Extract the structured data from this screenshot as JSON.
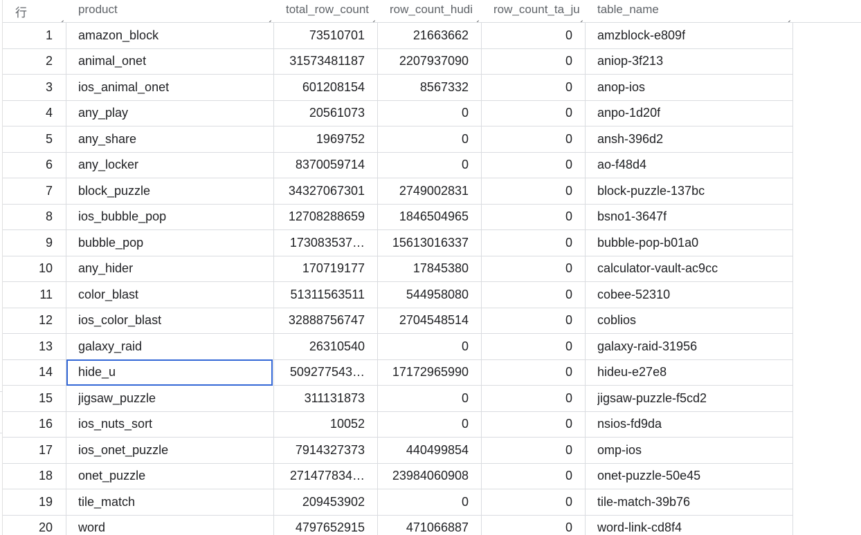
{
  "table": {
    "columns": {
      "row": "行",
      "product": "product",
      "total_row_count": "total_row_count",
      "row_count_hudi": "row_count_hudi",
      "row_count_ta_ju": "row_count_ta_ju",
      "table_name": "table_name"
    },
    "selected_row_index": 14,
    "selected_column": "product",
    "rows": [
      {
        "n": "1",
        "product": "amazon_block",
        "total": "73510701",
        "hudi": "21663662",
        "ta": "0",
        "table_name": "amzblock-e809f"
      },
      {
        "n": "2",
        "product": "animal_onet",
        "total": "31573481187",
        "hudi": "2207937090",
        "ta": "0",
        "table_name": "aniop-3f213"
      },
      {
        "n": "3",
        "product": "ios_animal_onet",
        "total": "601208154",
        "hudi": "8567332",
        "ta": "0",
        "table_name": "anop-ios"
      },
      {
        "n": "4",
        "product": "any_play",
        "total": "20561073",
        "hudi": "0",
        "ta": "0",
        "table_name": "anpo-1d20f"
      },
      {
        "n": "5",
        "product": "any_share",
        "total": "1969752",
        "hudi": "0",
        "ta": "0",
        "table_name": "ansh-396d2"
      },
      {
        "n": "6",
        "product": "any_locker",
        "total": "8370059714",
        "hudi": "0",
        "ta": "0",
        "table_name": "ao-f48d4"
      },
      {
        "n": "7",
        "product": "block_puzzle",
        "total": "34327067301",
        "hudi": "2749002831",
        "ta": "0",
        "table_name": "block-puzzle-137bc"
      },
      {
        "n": "8",
        "product": "ios_bubble_pop",
        "total": "12708288659",
        "hudi": "1846504965",
        "ta": "0",
        "table_name": "bsno1-3647f"
      },
      {
        "n": "9",
        "product": "bubble_pop",
        "total": "173083537…",
        "hudi": "15613016337",
        "ta": "0",
        "table_name": "bubble-pop-b01a0"
      },
      {
        "n": "10",
        "product": "any_hider",
        "total": "170719177",
        "hudi": "17845380",
        "ta": "0",
        "table_name": "calculator-vault-ac9cc"
      },
      {
        "n": "11",
        "product": "color_blast",
        "total": "51311563511",
        "hudi": "544958080",
        "ta": "0",
        "table_name": "cobee-52310"
      },
      {
        "n": "12",
        "product": "ios_color_blast",
        "total": "32888756747",
        "hudi": "2704548514",
        "ta": "0",
        "table_name": "coblios"
      },
      {
        "n": "13",
        "product": "galaxy_raid",
        "total": "26310540",
        "hudi": "0",
        "ta": "0",
        "table_name": "galaxy-raid-31956"
      },
      {
        "n": "14",
        "product": "hide_u",
        "total": "509277543…",
        "hudi": "17172965990",
        "ta": "0",
        "table_name": "hideu-e27e8"
      },
      {
        "n": "15",
        "product": "jigsaw_puzzle",
        "total": "311131873",
        "hudi": "0",
        "ta": "0",
        "table_name": "jigsaw-puzzle-f5cd2"
      },
      {
        "n": "16",
        "product": "ios_nuts_sort",
        "total": "10052",
        "hudi": "0",
        "ta": "0",
        "table_name": "nsios-fd9da"
      },
      {
        "n": "17",
        "product": "ios_onet_puzzle",
        "total": "7914327373",
        "hudi": "440499854",
        "ta": "0",
        "table_name": "omp-ios"
      },
      {
        "n": "18",
        "product": "onet_puzzle",
        "total": "271477834…",
        "hudi": "23984060908",
        "ta": "0",
        "table_name": "onet-puzzle-50e45"
      },
      {
        "n": "19",
        "product": "tile_match",
        "total": "209453902",
        "hudi": "0",
        "ta": "0",
        "table_name": "tile-match-39b76"
      },
      {
        "n": "20",
        "product": "word",
        "total": "4797652915",
        "hudi": "471066887",
        "ta": "0",
        "table_name": "word-link-cd8f4"
      }
    ]
  },
  "colors": {
    "selection": "#3367d6",
    "gridline": "#dadce0",
    "header_text": "#5f6368",
    "cell_text": "#202124"
  },
  "icons": {
    "column_resize": "resize-handle-icon"
  }
}
